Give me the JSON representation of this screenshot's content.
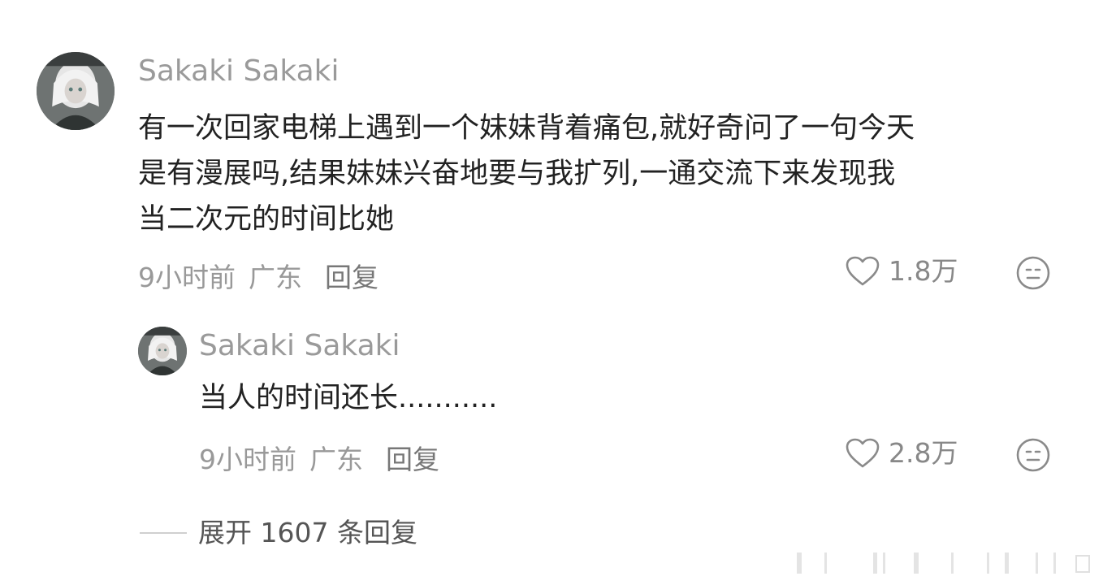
{
  "comment": {
    "username": "Sakaki Sakaki",
    "lines": [
      "有一次回家电梯上遇到一个妹妹背着痛包,就好奇问了一句今天",
      "是有漫展吗,结果妹妹兴奋地要与我扩列,一通交流下来发现我",
      "当二次元的时间比她"
    ],
    "time": "9小时前",
    "location": "广东",
    "reply_label": "回复",
    "likes": "1.8万",
    "like_icon": "heart-outline-icon",
    "dislike_icon": "meh-face-icon"
  },
  "reply": {
    "username": "Sakaki Sakaki",
    "text": "当人的时间还长...........",
    "time": "9小时前",
    "location": "广东",
    "reply_label": "回复",
    "likes": "2.8万",
    "like_icon": "heart-outline-icon",
    "dislike_icon": "meh-face-icon"
  },
  "expand": {
    "label": "展开 1607 条回复"
  },
  "colors": {
    "username": "#9a9a9a",
    "content": "#222222",
    "meta": "#999999",
    "icon": "#888888"
  }
}
